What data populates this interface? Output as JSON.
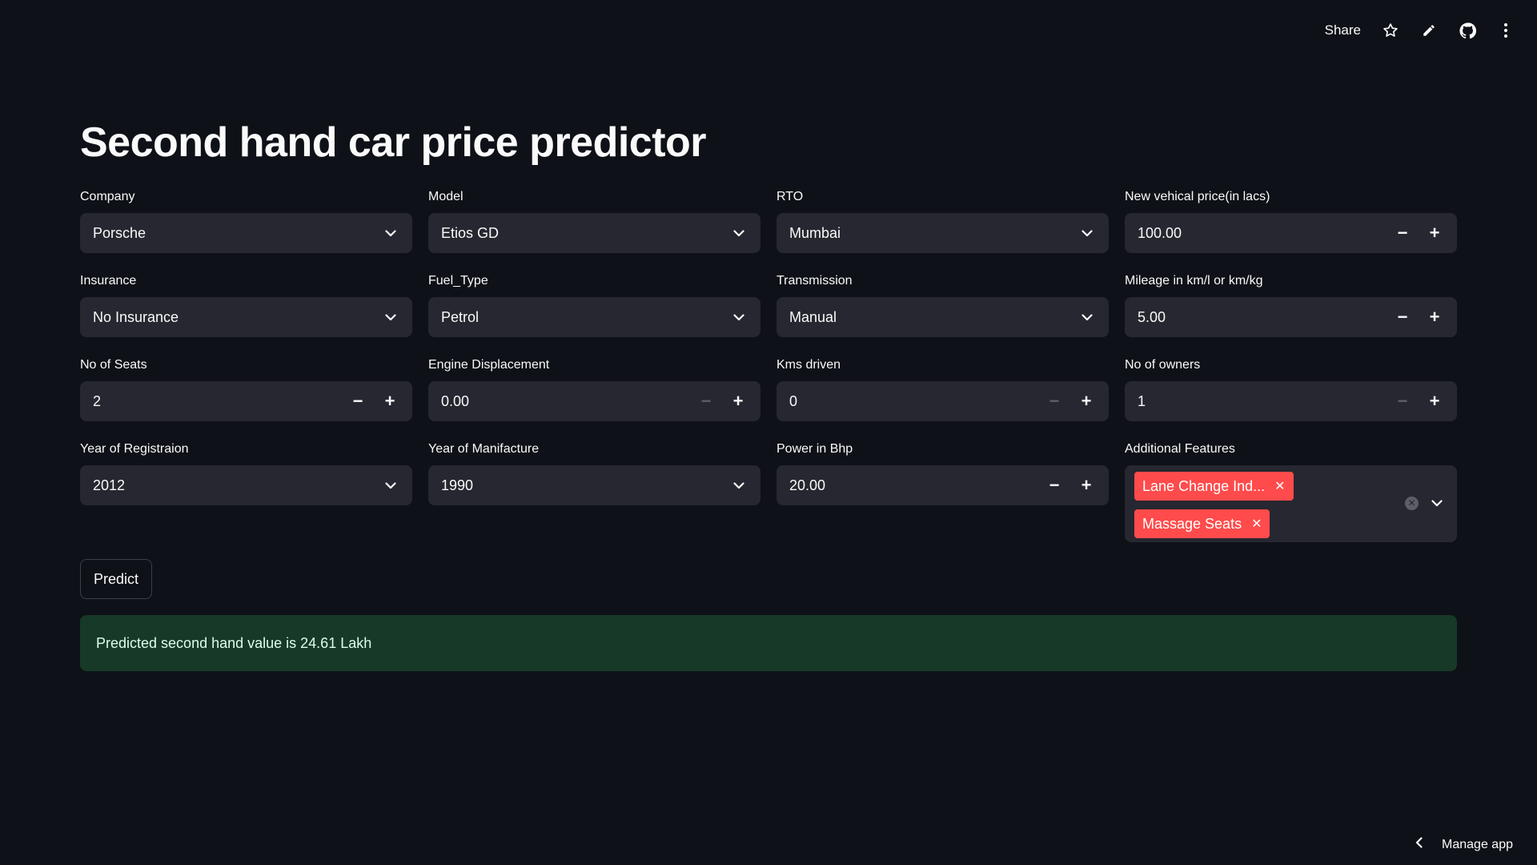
{
  "topbar": {
    "share_label": "Share",
    "icons": [
      "star-icon",
      "pencil-icon",
      "github-icon",
      "kebab-menu-icon"
    ]
  },
  "title": "Second hand car price predictor",
  "fields": {
    "company": {
      "label": "Company",
      "value": "Porsche"
    },
    "model": {
      "label": "Model",
      "value": "Etios GD"
    },
    "rto": {
      "label": "RTO",
      "value": "Mumbai"
    },
    "new_price": {
      "label": "New vehical price(in lacs)",
      "value": "100.00"
    },
    "insurance": {
      "label": "Insurance",
      "value": "No Insurance"
    },
    "fuel_type": {
      "label": "Fuel_Type",
      "value": "Petrol"
    },
    "transmission": {
      "label": "Transmission",
      "value": "Manual"
    },
    "mileage": {
      "label": "Mileage in km/l or km/kg",
      "value": "5.00"
    },
    "seats": {
      "label": "No of Seats",
      "value": "2"
    },
    "engine": {
      "label": "Engine Displacement",
      "value": "0.00"
    },
    "kms": {
      "label": "Kms driven",
      "value": "0"
    },
    "owners": {
      "label": "No of owners",
      "value": "1"
    },
    "year_reg": {
      "label": "Year of Registraion",
      "value": "2012"
    },
    "year_mfg": {
      "label": "Year of Manifacture",
      "value": "1990"
    },
    "power": {
      "label": "Power in Bhp",
      "value": "20.00"
    },
    "features": {
      "label": "Additional Features",
      "tags": [
        "Lane Change Ind...",
        "Massage Seats"
      ]
    }
  },
  "predict_label": "Predict",
  "result": "Predicted second hand value is 24.61 Lakh",
  "manage_label": "Manage app",
  "colors": {
    "background": "#0e1117",
    "input_bg": "#262730",
    "tag": "#ff4b4b",
    "success_bg": "#173928",
    "success_text": "#dffde9"
  }
}
